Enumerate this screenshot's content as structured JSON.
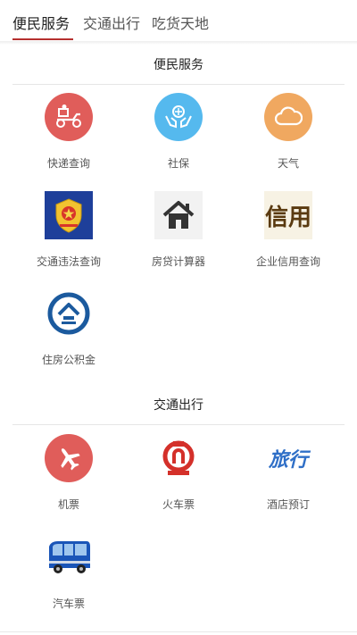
{
  "tabs": [
    {
      "label": "便民服务",
      "active": true
    },
    {
      "label": "交通出行",
      "active": false
    },
    {
      "label": "吃货天地",
      "active": false
    }
  ],
  "sections": [
    {
      "title": "便民服务",
      "items": [
        {
          "label": "快递查询",
          "icon": "delivery-scooter-icon",
          "color": "#e05d5a"
        },
        {
          "label": "社保",
          "icon": "social-security-hands-icon",
          "color": "#55b9ee"
        },
        {
          "label": "天气",
          "icon": "cloud-icon",
          "color": "#f0a860"
        },
        {
          "label": "交通违法查询",
          "icon": "police-badge-icon",
          "color": "#1e3f9a"
        },
        {
          "label": "房贷计算器",
          "icon": "house-icon",
          "color": "#333333"
        },
        {
          "label": "企业信用查询",
          "icon": "credit-text-icon",
          "text": "信用",
          "color": "#5a3a10"
        },
        {
          "label": "住房公积金",
          "icon": "housing-fund-logo-icon",
          "color": "#1b5a9e"
        }
      ]
    },
    {
      "title": "交通出行",
      "items": [
        {
          "label": "机票",
          "icon": "airplane-icon",
          "color": "#e05d5a"
        },
        {
          "label": "火车票",
          "icon": "railway-logo-icon",
          "color": "#d4302a"
        },
        {
          "label": "酒店预订",
          "icon": "travel-text-icon",
          "text": "旅行",
          "color": "#2f6fc7"
        },
        {
          "label": "汽车票",
          "icon": "bus-icon",
          "color": "#1a55b8"
        }
      ]
    }
  ]
}
